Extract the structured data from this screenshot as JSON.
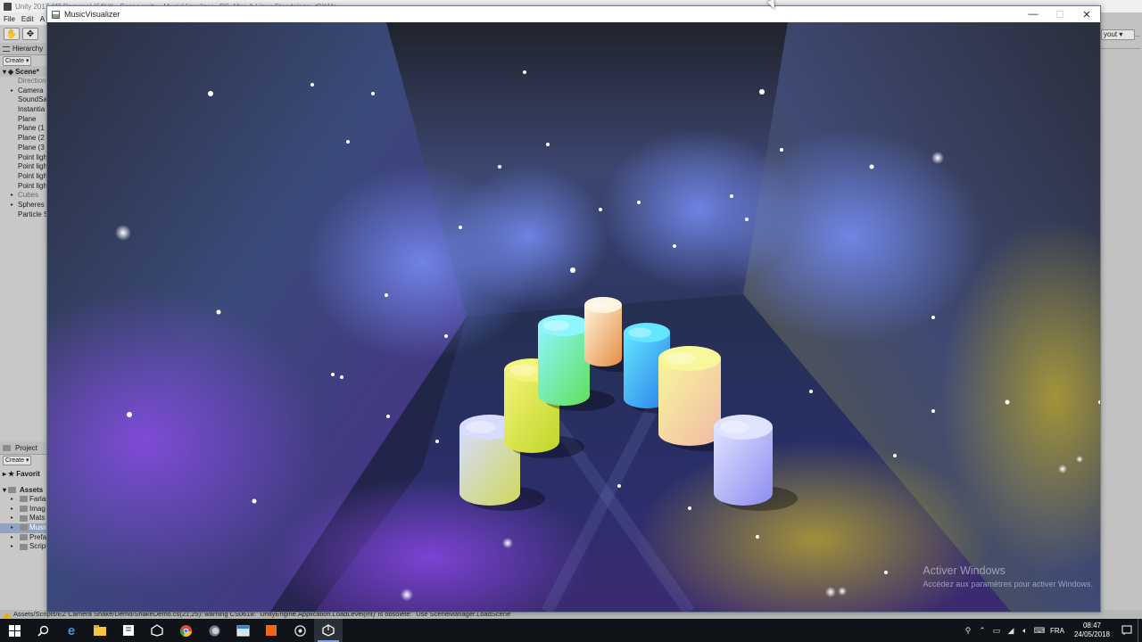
{
  "unity": {
    "title": "Unity 2017.1f3 Personal (64bit) - Scene.unity - MusicVisualizer - PC, Mac & Linux Standalone <DX11>",
    "menu": [
      "File",
      "Edit",
      "A"
    ],
    "layout_label": "yout",
    "hierarchy": {
      "tab": "Hierarchy",
      "create": "Create",
      "scene": "Scene*",
      "items": [
        {
          "label": "Direction",
          "expand": false,
          "dim": true
        },
        {
          "label": "Camera",
          "expand": true,
          "dim": false
        },
        {
          "label": "SoundSa",
          "expand": false,
          "dim": false
        },
        {
          "label": "Instantia",
          "expand": false,
          "dim": false
        },
        {
          "label": "Plane",
          "expand": false,
          "dim": false
        },
        {
          "label": "Plane (1",
          "expand": false,
          "dim": false
        },
        {
          "label": "Plane (2",
          "expand": false,
          "dim": false
        },
        {
          "label": "Plane (3",
          "expand": false,
          "dim": false
        },
        {
          "label": "Point ligh",
          "expand": false,
          "dim": false
        },
        {
          "label": "Point ligh",
          "expand": false,
          "dim": false
        },
        {
          "label": "Point ligh",
          "expand": false,
          "dim": false
        },
        {
          "label": "Point ligh",
          "expand": false,
          "dim": false
        },
        {
          "label": "Cubes",
          "expand": true,
          "dim": true
        },
        {
          "label": "Spheres",
          "expand": true,
          "dim": false
        },
        {
          "label": "Particle S",
          "expand": false,
          "dim": false
        }
      ]
    },
    "project": {
      "tab": "Project",
      "create": "Create",
      "favorites": "Favorit",
      "assets": "Assets",
      "items": [
        {
          "label": "Farlan",
          "selected": false
        },
        {
          "label": "Imag",
          "selected": false
        },
        {
          "label": "Mats",
          "selected": false
        },
        {
          "label": "Music",
          "selected": true
        },
        {
          "label": "Prefa",
          "selected": false
        },
        {
          "label": "Script",
          "selected": false
        }
      ]
    },
    "console_message": "Assets/Scripts/EZ Camera Shake/Demo/ShakeDemo.cs(21,25): warning CS0618: `UnityEngine.Application.LoadLevel(int)' is obsolete: `Use SceneManager.LoadScene'"
  },
  "game_window": {
    "title": "MusicVisualizer",
    "controls": {
      "minimize": "—",
      "maximize": "☐",
      "close": "✕"
    },
    "watermark": {
      "title": "Activer Windows",
      "subtitle": "Accédez aux paramètres pour activer Windows."
    },
    "cylinders": [
      {
        "name": "lavender",
        "top": "#d7dcff",
        "bottom": "#cfd85a"
      },
      {
        "name": "yellow",
        "top": "#f4f37a",
        "bottom": "#bfd626"
      },
      {
        "name": "cyan-green",
        "top": "#8ff6ff",
        "bottom": "#5fe05a"
      },
      {
        "name": "orange",
        "top": "#fff4dc",
        "bottom": "#e58d43"
      },
      {
        "name": "blue",
        "top": "#63e6ff",
        "bottom": "#2a7ee8"
      },
      {
        "name": "yellow-pink",
        "top": "#f8f79a",
        "bottom": "#f2b9a8"
      },
      {
        "name": "lavender-right",
        "top": "#dfe3ff",
        "bottom": "#8c8cf0"
      }
    ]
  },
  "taskbar": {
    "apps": [
      "start-icon",
      "search-icon",
      "edge-icon",
      "file-explorer-icon",
      "notepad-icon",
      "unity-hub-icon",
      "chrome-icon",
      "media-icon",
      "window-app-icon",
      "orange-app-icon",
      "blender-icon",
      "unity-icon"
    ],
    "language": "FRA",
    "time": "08:47",
    "date": "24/05/2018"
  }
}
